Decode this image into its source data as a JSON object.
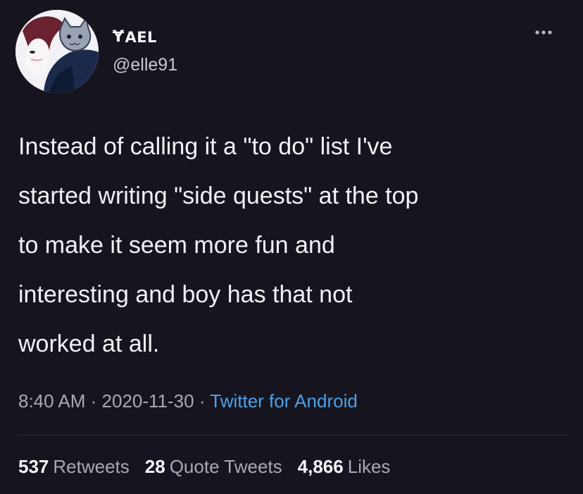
{
  "tweet": {
    "display_name_glyph": "Ɏ",
    "display_name": "AEL",
    "handle": "@elle91",
    "more_icon": "ellipsis-icon",
    "text": "Instead of calling it a \"to do\" list I've\nstarted writing \"side quests\" at the top\nto make it seem more fun and\ninteresting and boy has that not\nworked at all.",
    "time": "8:40 AM",
    "separator": "·",
    "date": "2020-11-30",
    "source": "Twitter for Android",
    "stats": {
      "retweets_count": "537",
      "retweets_label": "Retweets",
      "quotes_count": "28",
      "quotes_label": "Quote Tweets",
      "likes_count": "4,866",
      "likes_label": "Likes"
    }
  },
  "colors": {
    "background": "#16151f",
    "text": "#f1f1f5",
    "muted": "#a9a8b6",
    "link": "#4da0e6"
  }
}
